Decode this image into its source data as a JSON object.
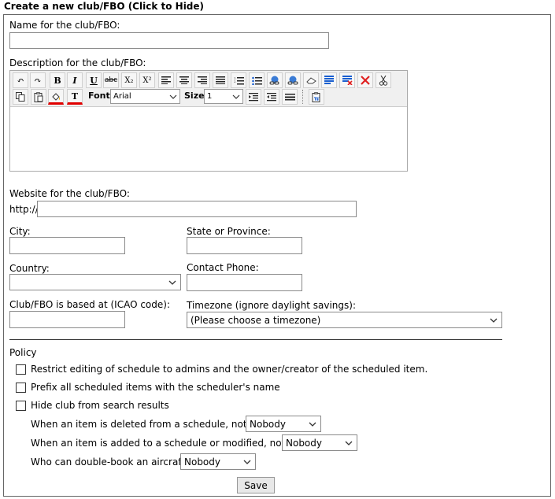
{
  "header": {
    "title": "Create a new club/FBO (Click to Hide)"
  },
  "form": {
    "name_label": "Name for the club/FBO:",
    "name_value": "",
    "description_label": "Description for the club/FBO:",
    "editor": {
      "font_label": "Font",
      "font_value": "Arial",
      "size_label": "Size",
      "size_value": "1",
      "buttons_row1": [
        "undo",
        "redo",
        "bold",
        "italic",
        "underline",
        "strikethrough",
        "subscript",
        "superscript",
        "align-left",
        "align-center",
        "align-right",
        "justify",
        "ordered-list",
        "unordered-list",
        "link",
        "unlink",
        "eraser",
        "paragraph",
        "remove-format",
        "delete",
        "cut"
      ],
      "buttons_row2": [
        "copy",
        "paste",
        "highlight-color",
        "text-color",
        "indent",
        "outdent",
        "horizontal-rule",
        "paste-word"
      ]
    },
    "website_label": "Website for the club/FBO:",
    "website_prefix": "http://",
    "city_label": "City:",
    "state_label": "State or Province:",
    "country_label": "Country:",
    "country_value": "",
    "phone_label": "Contact Phone:",
    "icao_label": "Club/FBO is based at (ICAO code):",
    "timezone_label": "Timezone (ignore daylight savings):",
    "timezone_value": "(Please choose a timezone)",
    "policy_label": "Policy",
    "policy_items": [
      "Restrict editing of schedule to admins and the owner/creator of the scheduled item.",
      "Prefix all scheduled items with the scheduler's name",
      "Hide club from search results"
    ],
    "notify_delete_label": "When an item is deleted from a schedule, notify:",
    "notify_delete_value": "Nobody",
    "notify_add_label": "When an item is added to a schedule or modified, notify:",
    "notify_add_value": "Nobody",
    "double_book_label": "Who can double-book an aircraft:",
    "double_book_value": "Nobody",
    "save_label": "Save"
  },
  "colors": {
    "underline_red": "#e00000",
    "icon_blue": "#1a5fd0",
    "delete_red": "#e02020"
  }
}
